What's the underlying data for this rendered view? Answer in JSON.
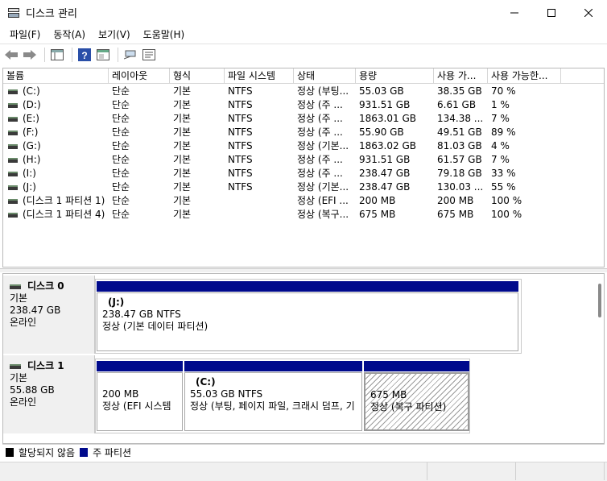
{
  "window": {
    "title": "디스크 관리"
  },
  "menu": [
    "파일(F)",
    "동작(A)",
    "보기(V)",
    "도움말(H)"
  ],
  "toolbar": {
    "icons": [
      "back-arrow-icon",
      "forward-arrow-icon",
      "console-icon",
      "help-icon",
      "show-hide-icon",
      "connect-icon",
      "properties-icon"
    ]
  },
  "volume_list": {
    "headers": [
      "볼륨",
      "레이아웃",
      "형식",
      "파일 시스템",
      "상태",
      "용량",
      "사용 가...",
      "사용 가능한..."
    ],
    "rows": [
      [
        "(C:)",
        "단순",
        "기본",
        "NTFS",
        "정상 (부팅...",
        "55.03 GB",
        "38.35 GB",
        "70 %"
      ],
      [
        "(D:)",
        "단순",
        "기본",
        "NTFS",
        "정상 (주 ...",
        "931.51 GB",
        "6.61 GB",
        "1 %"
      ],
      [
        "(E:)",
        "단순",
        "기본",
        "NTFS",
        "정상 (주 ...",
        "1863.01 GB",
        "134.38 ...",
        "7 %"
      ],
      [
        "(F:)",
        "단순",
        "기본",
        "NTFS",
        "정상 (주 ...",
        "55.90 GB",
        "49.51 GB",
        "89 %"
      ],
      [
        "(G:)",
        "단순",
        "기본",
        "NTFS",
        "정상 (기본...",
        "1863.02 GB",
        "81.03 GB",
        "4 %"
      ],
      [
        "(H:)",
        "단순",
        "기본",
        "NTFS",
        "정상 (주 ...",
        "931.51 GB",
        "61.57 GB",
        "7 %"
      ],
      [
        "(I:)",
        "단순",
        "기본",
        "NTFS",
        "정상 (주 ...",
        "238.47 GB",
        "79.18 GB",
        "33 %"
      ],
      [
        "(J:)",
        "단순",
        "기본",
        "NTFS",
        "정상 (기본...",
        "238.47 GB",
        "130.03 ...",
        "55 %"
      ],
      [
        "(디스크 1 파티션 1)",
        "단순",
        "기본",
        "",
        "정상 (EFI ...",
        "200 MB",
        "200 MB",
        "100 %"
      ],
      [
        "(디스크 1 파티션 4)",
        "단순",
        "기본",
        "",
        "정상 (복구...",
        "675 MB",
        "675 MB",
        "100 %"
      ]
    ]
  },
  "disks": [
    {
      "name": "디스크 0",
      "type": "기본",
      "size": "238.47 GB",
      "status": "온라인",
      "partitions": [
        {
          "label": "(J:)",
          "size_fs": "238.47 GB NTFS",
          "status": "정상 (기본 데이터 파티션)"
        }
      ]
    },
    {
      "name": "디스크 1",
      "type": "기본",
      "size": "55.88 GB",
      "status": "온라인",
      "partitions": [
        {
          "label": "",
          "size_fs": "200 MB",
          "status": "정상 (EFI 시스템"
        },
        {
          "label": "(C:)",
          "size_fs": "55.03 GB NTFS",
          "status": "정상 (부팅, 페이지 파일, 크래시 덤프, 기"
        },
        {
          "label": "",
          "size_fs": "675 MB",
          "status": "정상 (복구 파티션)"
        }
      ]
    }
  ],
  "legend": [
    {
      "label": "할당되지 않음",
      "color": "#000000"
    },
    {
      "label": "주 파티션",
      "color": "#000a8c"
    }
  ]
}
